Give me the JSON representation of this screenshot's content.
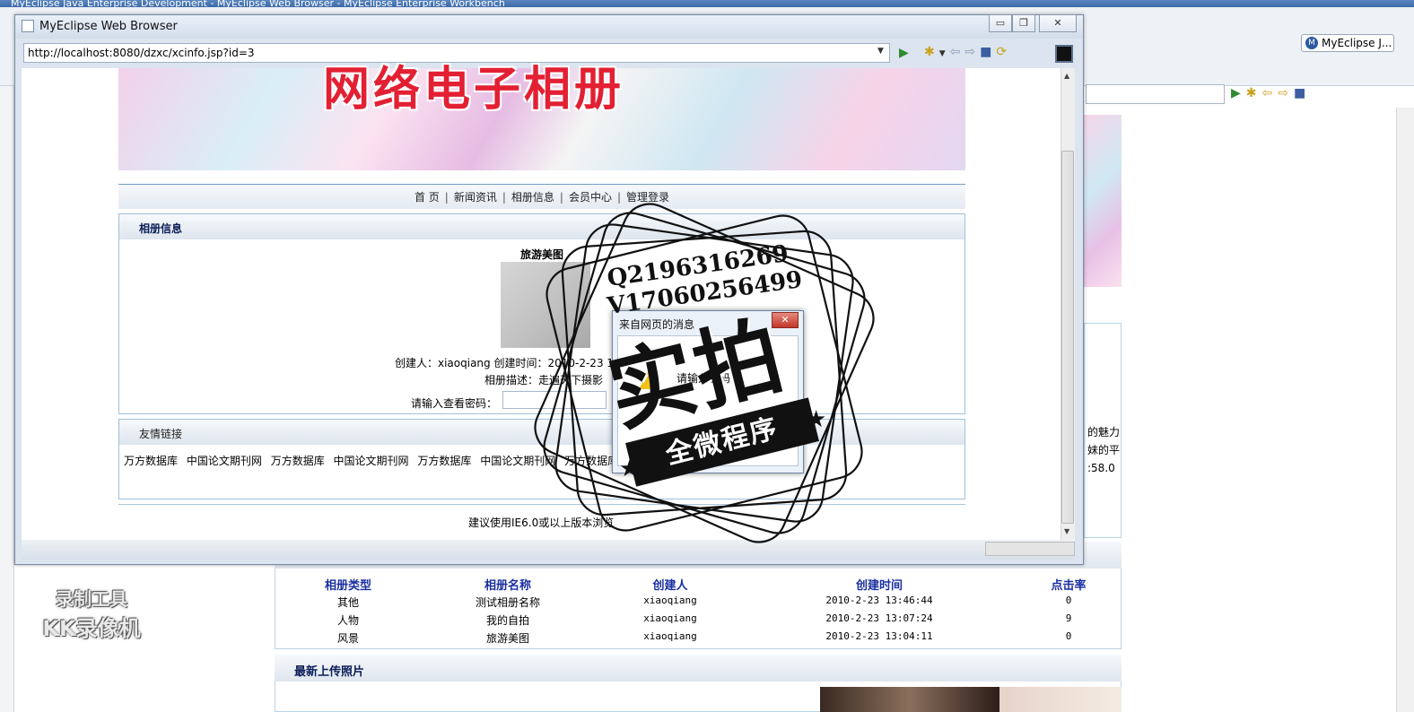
{
  "workbench": {
    "title": "MyEclipse Java Enterprise Development - MyEclipse Web Browser - MyEclipse Enterprise Workbench",
    "perspective_label": "MyEclipse J...",
    "bg_right_text": [
      "的魅力",
      "妹的平",
      ":58.0"
    ],
    "album_table": {
      "headers": [
        "相册类型",
        "相册名称",
        "创建人",
        "创建时间",
        "点击率"
      ],
      "rows": [
        [
          "其他",
          "测试相册名称",
          "xiaoqiang",
          "2010-2-23 13:46:44",
          "0"
        ],
        [
          "人物",
          "我的自拍",
          "xiaoqiang",
          "2010-2-23 13:07:24",
          "9"
        ],
        [
          "风景",
          "旅游美图",
          "xiaoqiang",
          "2010-2-23 13:04:11",
          "0"
        ]
      ]
    },
    "latest_title": "最新上传照片",
    "kk_logo": [
      "录制工具",
      "KK录像机"
    ]
  },
  "browser": {
    "title": "MyEclipse Web Browser",
    "url": "http://localhost:8080/dzxc/xcinfo.jsp?id=3",
    "colors": {
      "accent": "#1a2fa0",
      "banner_text": "#e32033",
      "border": "#9fc0dc"
    }
  },
  "page": {
    "banner_text": "网络电子相册",
    "nav": [
      "首 页",
      "新闻资讯",
      "相册信息",
      "会员中心",
      "管理登录"
    ],
    "info_title": "相册信息",
    "album_name": "旅游美图",
    "creator_line": "创建人：xiaoqiang 创建时间：2010-2-23 13",
    "desc_line": "相册描述：走遍天下摄影",
    "pwd_label": "请输入查看密码：",
    "links_title": "友情链接",
    "links": [
      "万方数据库",
      "中国论文期刊网",
      "万方数据库",
      "中国论文期刊网",
      "万方数据库",
      "中国论文期刊网",
      "万方数据库",
      "中"
    ],
    "footer": "建议使用IE6.0或以上版本浏览"
  },
  "dialog": {
    "title": "来自网页的消息",
    "message": "请输入密码"
  },
  "watermark": {
    "qq": "Q2196316269",
    "vx": "V17060256499",
    "big": "实拍",
    "ribbon": "全微程序"
  }
}
